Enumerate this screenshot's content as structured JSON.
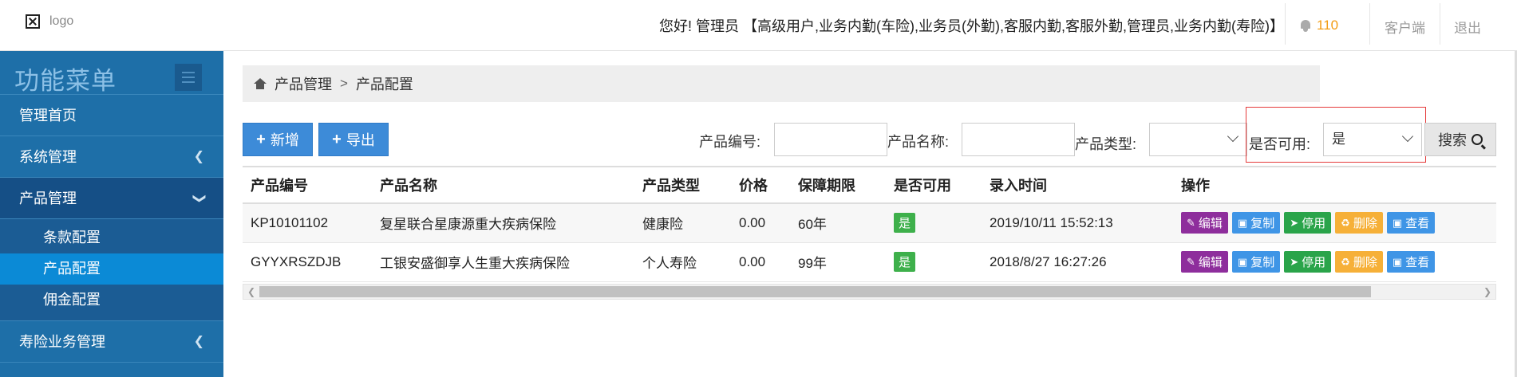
{
  "header": {
    "logo_text": "logo",
    "greeting": "您好!  管理员 【高级用户,业务内勤(车险),业务员(外勤),客服内勤,客服外勤,管理员,业务内勤(寿险)】",
    "notification_count": "110",
    "client_link": "客户端",
    "logout_link": "退出"
  },
  "sidebar": {
    "title": "功能菜单",
    "items": [
      {
        "label": "管理首页"
      },
      {
        "label": "系统管理",
        "icon": "chevron-left"
      },
      {
        "label": "产品管理",
        "icon": "chevron-down"
      },
      {
        "label": "寿险业务管理",
        "icon": "chevron-left"
      }
    ],
    "subitems": [
      {
        "label": "条款配置"
      },
      {
        "label": "产品配置"
      },
      {
        "label": "佣金配置"
      }
    ]
  },
  "breadcrumb": {
    "level1": "产品管理",
    "separator": ">",
    "level2": "产品配置"
  },
  "toolbar": {
    "add_label": "新增",
    "export_label": "导出"
  },
  "filters": {
    "product_code_label": "产品编号:",
    "product_code_value": "",
    "product_name_label": "产品名称:",
    "product_name_value": "",
    "product_type_label": "产品类型:",
    "product_type_value": "",
    "available_label": "是否可用:",
    "available_value": "是",
    "search_label": "搜索"
  },
  "table": {
    "headers": [
      "产品编号",
      "产品名称",
      "产品类型",
      "价格",
      "保障期限",
      "是否可用",
      "录入时间",
      "操作"
    ],
    "rows": [
      {
        "code": "KP10101102",
        "name": "复星联合星康源重大疾病保险",
        "type": "健康险",
        "price": "0.00",
        "term": "60年",
        "available": "是",
        "time": "2019/10/11 15:52:13"
      },
      {
        "code": "GYYXRSZDJB",
        "name": "工银安盛御享人生重大疾病保险",
        "type": "个人寿险",
        "price": "0.00",
        "term": "99年",
        "available": "是",
        "time": "2018/8/27 16:27:26"
      }
    ],
    "actions": {
      "edit": "编辑",
      "copy": "复制",
      "disable": "停用",
      "delete": "删除",
      "view": "查看"
    }
  },
  "colors": {
    "sidebar_bg": "#1e6fa8",
    "active_subitem": "#0b8ad6",
    "primary_button": "#3d8bd8",
    "available_badge": "#3eb04b",
    "edit_button": "#8e2e9c",
    "delete_button": "#f6b038",
    "highlight_border": "#e53b3b"
  }
}
